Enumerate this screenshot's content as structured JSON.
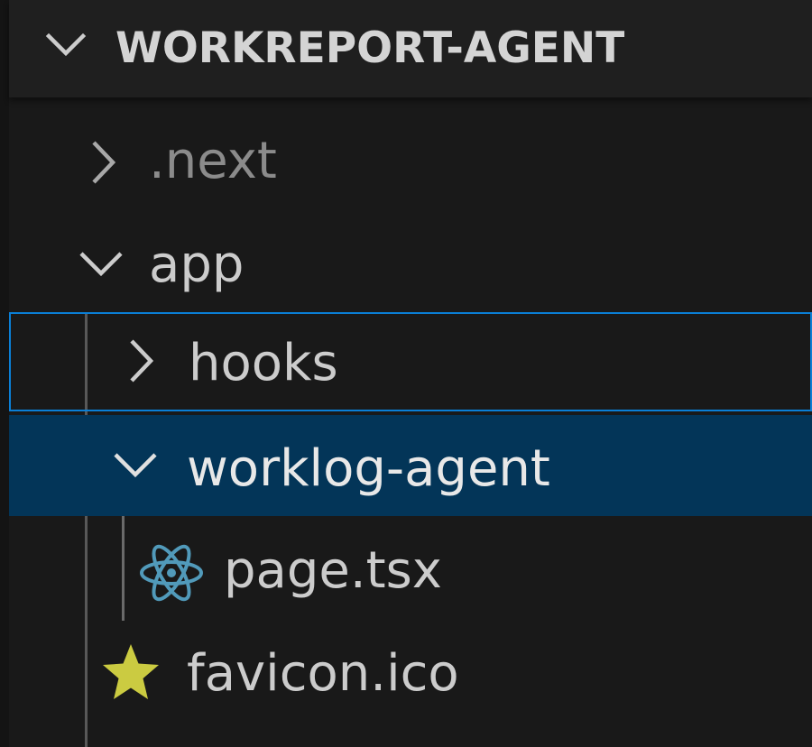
{
  "explorer": {
    "project_title": "WORKREPORT-AGENT",
    "items": [
      {
        "label": ".next",
        "state": "collapsed",
        "type": "folder"
      },
      {
        "label": "app",
        "state": "expanded",
        "type": "folder"
      },
      {
        "label": "hooks",
        "state": "collapsed",
        "type": "folder",
        "focused": true
      },
      {
        "label": "worklog-agent",
        "state": "expanded",
        "type": "folder",
        "selected": true
      },
      {
        "label": "page.tsx",
        "type": "file",
        "icon": "react-icon"
      },
      {
        "label": "favicon.ico",
        "type": "file",
        "icon": "star-icon"
      }
    ]
  },
  "colors": {
    "background": "#191919",
    "selected_row": "#033558",
    "focus_border": "#0a7fd6",
    "react_icon": "#519aba",
    "star_icon": "#cbcb41",
    "text": "#cccccc",
    "dimmed_text": "#8b8b8b"
  }
}
